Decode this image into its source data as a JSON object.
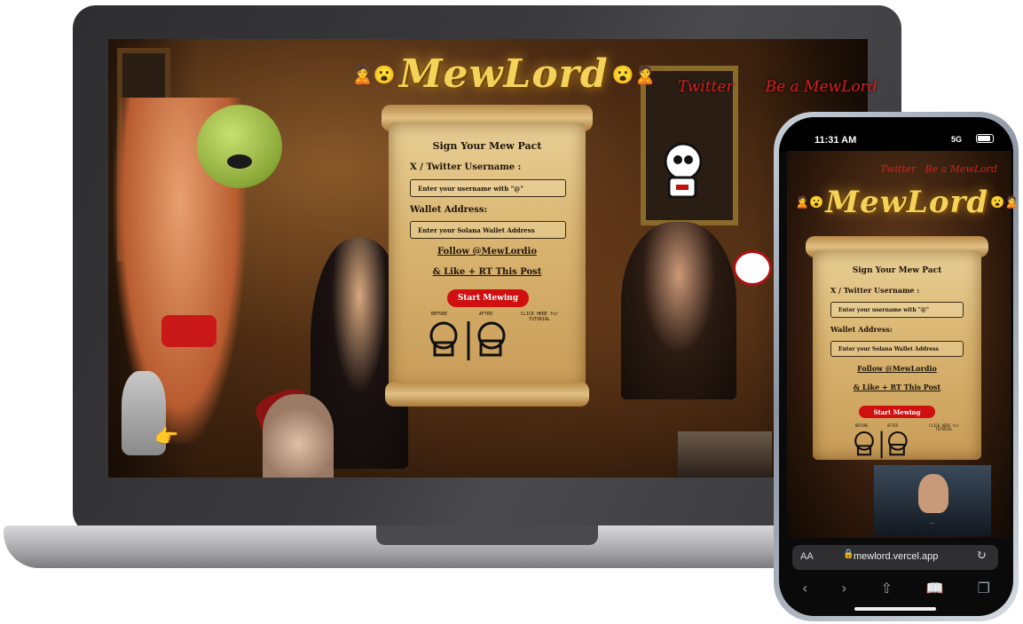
{
  "site": {
    "brand": "MewLord",
    "emoji_left": "🙎😮",
    "emoji_right": "😮🙎",
    "nav": [
      "Twitter",
      "Be a MewLord"
    ]
  },
  "form": {
    "title": "Sign Your Mew Pact",
    "username_label": "X / Twitter Username :",
    "username_placeholder": "Enter your username with \"@\"",
    "wallet_label": "Wallet Address:",
    "wallet_placeholder": "Enter your Solana Wallet Address",
    "follow_text": "Follow @MewLordio",
    "like_text": "& Like + RT This Post",
    "start_button": "Start Mewing",
    "before_label": "BEFORE",
    "after_label": "AFTER",
    "tutorial_text": "CLICK HERE for TUTORIAL"
  },
  "phone": {
    "time": "11:31 AM",
    "signal": "5G",
    "url": "mewlord.vercel.app",
    "text_size_button": "AA",
    "video_caption": "..."
  },
  "colors": {
    "brand_gold": "#f5d25a",
    "nav_red": "#d81e1e",
    "button_red": "#d01010",
    "parchment": "#d8b470"
  }
}
